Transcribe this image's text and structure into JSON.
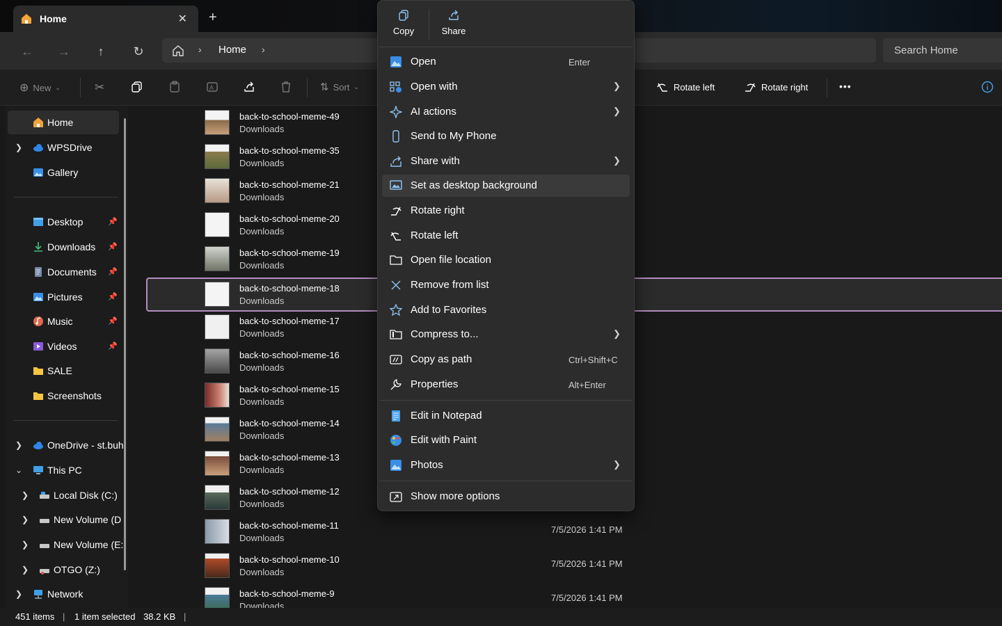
{
  "tab": {
    "title": "Home",
    "close": "✕",
    "new": "+"
  },
  "address": {
    "crumb": "Home",
    "search_placeholder": "Search Home"
  },
  "toolbar": {
    "new": "New",
    "sort": "Sort",
    "rotate_left": "Rotate left",
    "rotate_right": "Rotate right",
    "more": "•••"
  },
  "sidebar": {
    "items": [
      {
        "label": "Home"
      },
      {
        "label": "WPSDrive"
      },
      {
        "label": "Gallery"
      },
      {
        "label": "Desktop"
      },
      {
        "label": "Downloads"
      },
      {
        "label": "Documents"
      },
      {
        "label": "Pictures"
      },
      {
        "label": "Music"
      },
      {
        "label": "Videos"
      },
      {
        "label": "SALE"
      },
      {
        "label": "Screenshots"
      },
      {
        "label": "OneDrive - st.buh"
      },
      {
        "label": "This PC"
      },
      {
        "label": "Local Disk (C:)"
      },
      {
        "label": "New Volume (D"
      },
      {
        "label": "New Volume (E:"
      },
      {
        "label": "OTGO (Z:)"
      },
      {
        "label": "Network"
      }
    ]
  },
  "files": [
    {
      "name": "back-to-school-meme-49",
      "location": "Downloads",
      "date": ""
    },
    {
      "name": "back-to-school-meme-35",
      "location": "Downloads",
      "date": ""
    },
    {
      "name": "back-to-school-meme-21",
      "location": "Downloads",
      "date": ""
    },
    {
      "name": "back-to-school-meme-20",
      "location": "Downloads",
      "date": ""
    },
    {
      "name": "back-to-school-meme-19",
      "location": "Downloads",
      "date": ""
    },
    {
      "name": "back-to-school-meme-18",
      "location": "Downloads",
      "date": ""
    },
    {
      "name": "back-to-school-meme-17",
      "location": "Downloads",
      "date": ""
    },
    {
      "name": "back-to-school-meme-16",
      "location": "Downloads",
      "date": ""
    },
    {
      "name": "back-to-school-meme-15",
      "location": "Downloads",
      "date": ""
    },
    {
      "name": "back-to-school-meme-14",
      "location": "Downloads",
      "date": ""
    },
    {
      "name": "back-to-school-meme-13",
      "location": "Downloads",
      "date": ""
    },
    {
      "name": "back-to-school-meme-12",
      "location": "Downloads",
      "date": ""
    },
    {
      "name": "back-to-school-meme-11",
      "location": "Downloads",
      "date": "7/5/2026 1:41 PM"
    },
    {
      "name": "back-to-school-meme-10",
      "location": "Downloads",
      "date": "7/5/2026 1:41 PM"
    },
    {
      "name": "back-to-school-meme-9",
      "location": "Downloads",
      "date": "7/5/2026 1:41 PM"
    }
  ],
  "status": {
    "count": "451 items",
    "selected": "1 item selected",
    "size": "38.2 KB"
  },
  "context_menu": {
    "quick": {
      "copy": "Copy",
      "share": "Share"
    },
    "items": [
      {
        "label": "Open",
        "shortcut": "Enter"
      },
      {
        "label": "Open with"
      },
      {
        "label": "AI actions"
      },
      {
        "label": "Send to My Phone"
      },
      {
        "label": "Share with"
      },
      {
        "label": "Set as desktop background"
      },
      {
        "label": "Rotate right"
      },
      {
        "label": "Rotate left"
      },
      {
        "label": "Open file location"
      },
      {
        "label": "Remove from list"
      },
      {
        "label": "Add to Favorites"
      },
      {
        "label": "Compress to..."
      },
      {
        "label": "Copy as path",
        "shortcut": "Ctrl+Shift+C"
      },
      {
        "label": "Properties",
        "shortcut": "Alt+Enter"
      },
      {
        "label": "Edit in Notepad"
      },
      {
        "label": "Edit with Paint"
      },
      {
        "label": "Photos"
      },
      {
        "label": "Show more options"
      }
    ]
  },
  "colors": {
    "accent": "#b48ec0",
    "folder": "#f5c542",
    "blue": "#4aa3f0"
  }
}
